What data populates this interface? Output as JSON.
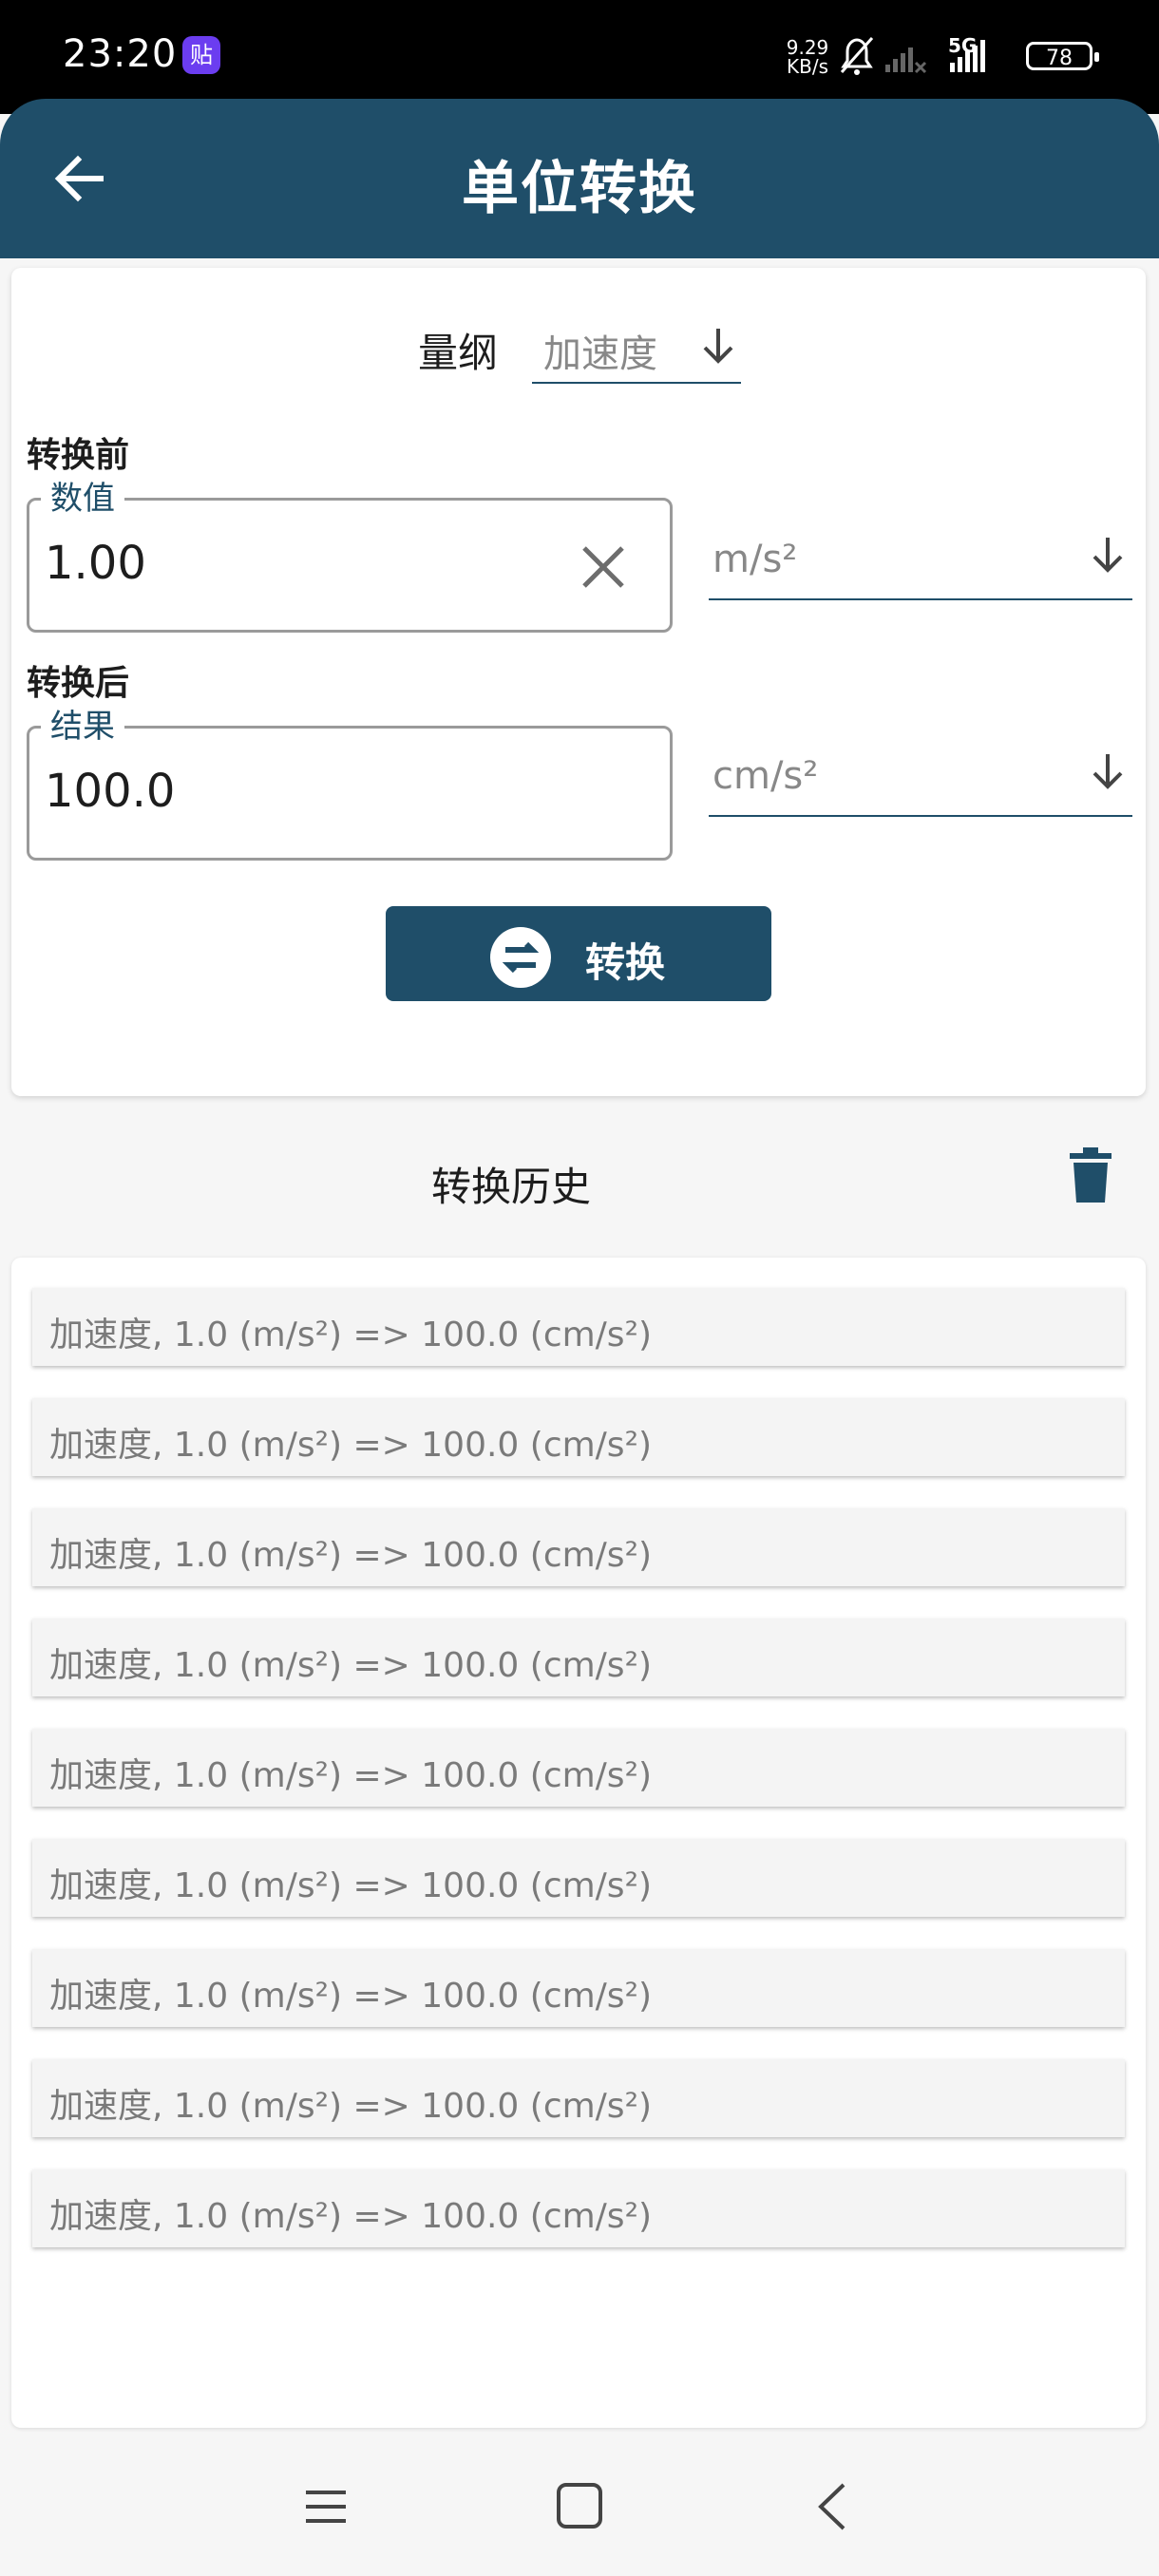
{
  "status_bar": {
    "time": "23:20",
    "app_badge": "贴",
    "net_speed_value": "9.29",
    "net_speed_unit": "KB/s",
    "network": "5G",
    "battery": "78"
  },
  "app_bar": {
    "title": "单位转换",
    "back_icon": "arrow-left-icon"
  },
  "converter": {
    "dimension_label": "量纲",
    "dimension_value": "加速度",
    "before_label": "转换前",
    "input_legend": "数值",
    "input_value": "1.00",
    "from_unit": "m/s²",
    "after_label": "转换后",
    "result_legend": "结果",
    "result_value": "100.0",
    "to_unit": "cm/s²",
    "convert_button": "转换"
  },
  "history": {
    "title": "转换历史",
    "items": [
      "加速度, 1.0 (m/s²) => 100.0 (cm/s²)",
      "加速度, 1.0 (m/s²) => 100.0 (cm/s²)",
      "加速度, 1.0 (m/s²) => 100.0 (cm/s²)",
      "加速度, 1.0 (m/s²) => 100.0 (cm/s²)",
      "加速度, 1.0 (m/s²) => 100.0 (cm/s²)",
      "加速度, 1.0 (m/s²) => 100.0 (cm/s²)",
      "加速度, 1.0 (m/s²) => 100.0 (cm/s²)",
      "加速度, 1.0 (m/s²) => 100.0 (cm/s²)",
      "加速度, 1.0 (m/s²) => 100.0 (cm/s²)"
    ]
  },
  "colors": {
    "primary": "#1f4e69",
    "background": "#f6f6f6"
  }
}
